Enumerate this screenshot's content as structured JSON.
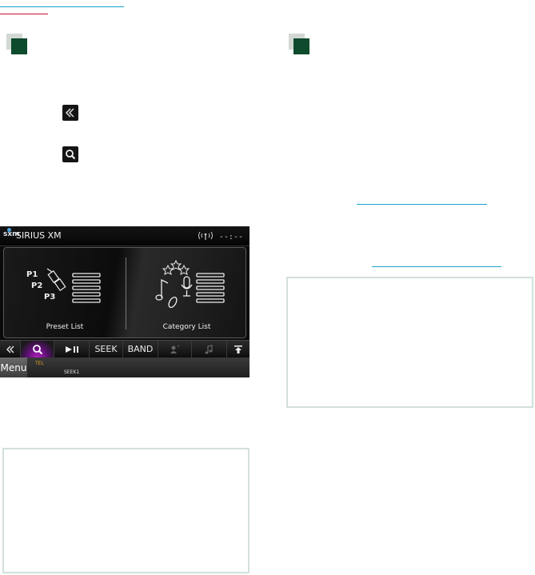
{
  "device": {
    "brand_logo": "sxm",
    "title": "SIRIUS XM",
    "status": "--:--",
    "preset": {
      "labels": [
        "P1",
        "P2",
        "P3"
      ],
      "caption": "Preset List"
    },
    "category": {
      "caption": "Category List"
    },
    "toolbar": {
      "back_icon": "double-chevron-left-icon",
      "search_icon": "search-icon",
      "play_pause_icon": "play-pause-icon",
      "seek_label": "SEEK",
      "band_label": "BAND",
      "upload_icon": "upload-icon"
    },
    "bottom": {
      "menu_label": "Menu",
      "tel_label": "TEL",
      "seek_status": "SEEK1"
    }
  },
  "colors": {
    "accent_link": "#1aa3c9",
    "accent_red": "#c8102e",
    "step_marker": "#0e4a2c",
    "note_border": "#d3e0dc",
    "search_highlight": "#b020c0"
  }
}
